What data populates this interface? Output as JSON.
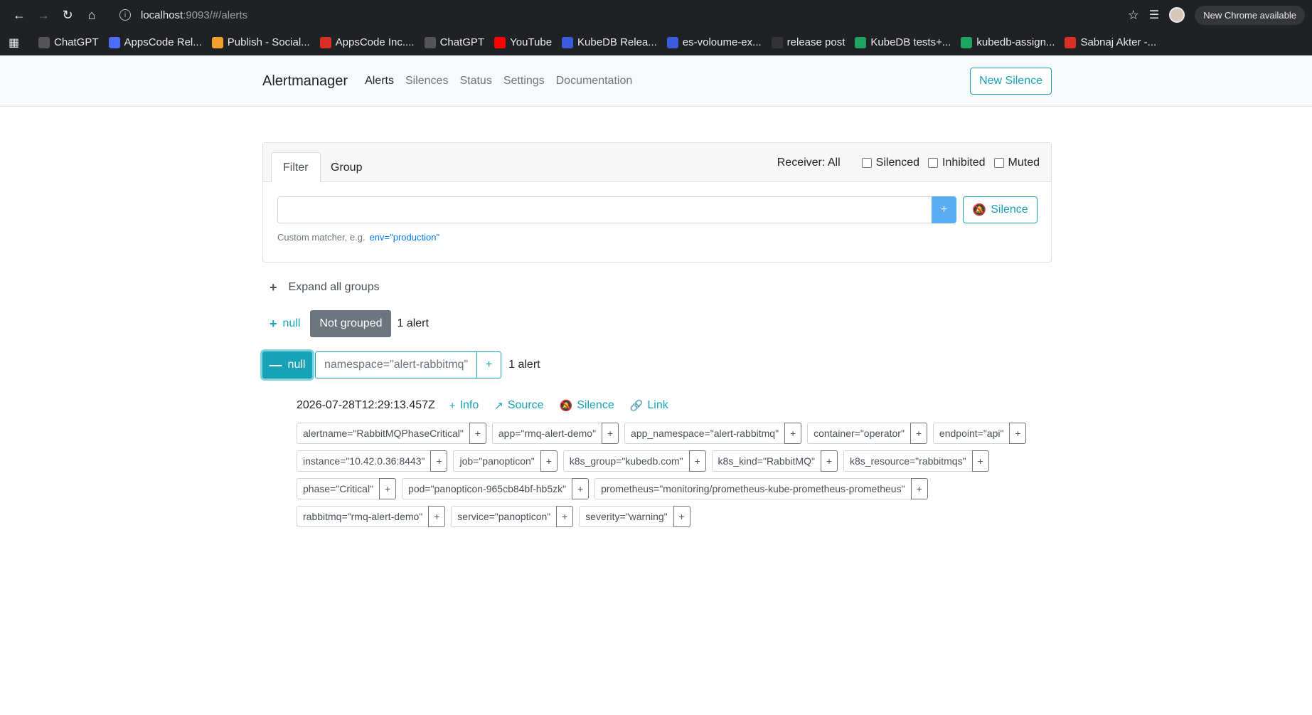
{
  "browser": {
    "url_host": "localhost",
    "url_path": ":9093/#/alerts",
    "update_label": "New Chrome available"
  },
  "bookmarks": [
    {
      "label": "ChatGPT",
      "color": "#555555"
    },
    {
      "label": "AppsCode Rel...",
      "color": "#4a6cf7"
    },
    {
      "label": "Publish - Social...",
      "color": "#f0a030"
    },
    {
      "label": "AppsCode Inc....",
      "color": "#d93025"
    },
    {
      "label": "ChatGPT",
      "color": "#555555"
    },
    {
      "label": "YouTube",
      "color": "#ff0000"
    },
    {
      "label": "KubeDB Relea...",
      "color": "#3b5bdb"
    },
    {
      "label": "es-voloume-ex...",
      "color": "#3b5bdb"
    },
    {
      "label": "release post",
      "color": "#333333"
    },
    {
      "label": "KubeDB tests+...",
      "color": "#1ea362"
    },
    {
      "label": "kubedb-assign...",
      "color": "#1ea362"
    },
    {
      "label": "Sabnaj Akter -...",
      "color": "#d93025"
    }
  ],
  "navbar": {
    "brand": "Alertmanager",
    "links": [
      "Alerts",
      "Silences",
      "Status",
      "Settings",
      "Documentation"
    ],
    "new_silence": "New Silence"
  },
  "filter": {
    "tab_filter": "Filter",
    "tab_group": "Group",
    "receiver": "Receiver: All",
    "silenced": "Silenced",
    "inhibited": "Inhibited",
    "muted": "Muted",
    "input_value": "",
    "plus": "+",
    "silence_btn": "Silence",
    "hint": "Custom matcher, e.g.",
    "hint_example": "env=\"production\""
  },
  "expand_all": "Expand all groups",
  "group1": {
    "null": "null",
    "badge": "Not grouped",
    "count": "1 alert"
  },
  "group2": {
    "null": "null",
    "namespace": "namespace=\"alert-rabbitmq\"",
    "plus": "+",
    "count": "1 alert"
  },
  "alert": {
    "timestamp": "2026-07-28T12:29:13.457Z",
    "info": "Info",
    "source": "Source",
    "silence": "Silence",
    "link": "Link",
    "labels": [
      "alertname=\"RabbitMQPhaseCritical\"",
      "app=\"rmq-alert-demo\"",
      "app_namespace=\"alert-rabbitmq\"",
      "container=\"operator\"",
      "endpoint=\"api\"",
      "instance=\"10.42.0.36:8443\"",
      "job=\"panopticon\"",
      "k8s_group=\"kubedb.com\"",
      "k8s_kind=\"RabbitMQ\"",
      "k8s_resource=\"rabbitmqs\"",
      "phase=\"Critical\"",
      "pod=\"panopticon-965cb84bf-hb5zk\"",
      "prometheus=\"monitoring/prometheus-kube-prometheus-prometheus\"",
      "rabbitmq=\"rmq-alert-demo\"",
      "service=\"panopticon\"",
      "severity=\"warning\""
    ]
  }
}
